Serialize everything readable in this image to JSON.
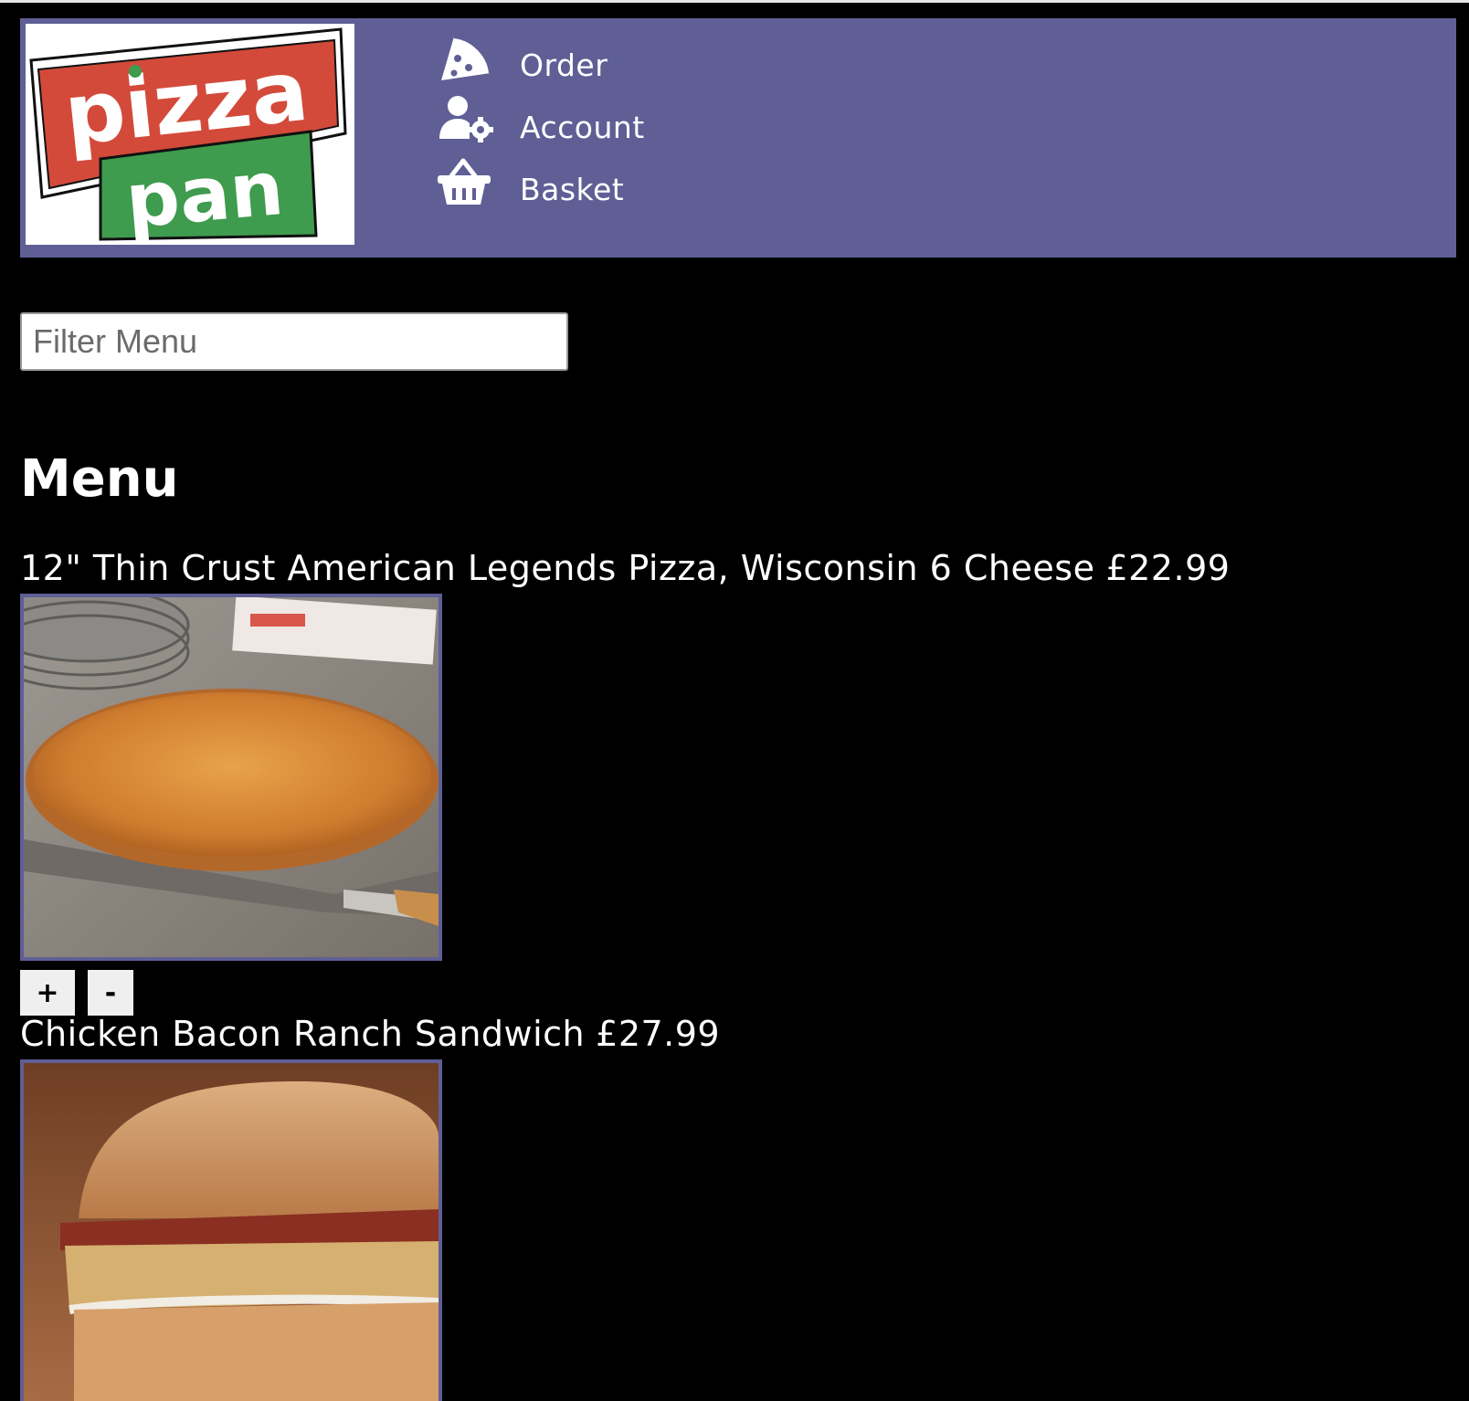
{
  "logo": {
    "line1": "pizza",
    "line2": "pan"
  },
  "nav": {
    "items": [
      {
        "label": "Order",
        "icon": "pizza-slice-icon"
      },
      {
        "label": "Account",
        "icon": "user-cog-icon"
      },
      {
        "label": "Basket",
        "icon": "basket-icon"
      }
    ]
  },
  "filter": {
    "placeholder": "Filter Menu",
    "value": ""
  },
  "menu": {
    "title": "Menu",
    "items": [
      {
        "name": "12\" Thin Crust American Legends Pizza, Wisconsin 6 Cheese",
        "price": "£22.99",
        "image": "pizza-photo",
        "plus_label": "+",
        "minus_label": "-"
      },
      {
        "name": "Chicken Bacon Ranch Sandwich",
        "price": "£27.99",
        "image": "sandwich-photo"
      }
    ]
  },
  "colors": {
    "header_bg": "#5f5f96",
    "page_bg": "#000000",
    "logo_red": "#d34a3a",
    "logo_green": "#3f9b4e"
  }
}
